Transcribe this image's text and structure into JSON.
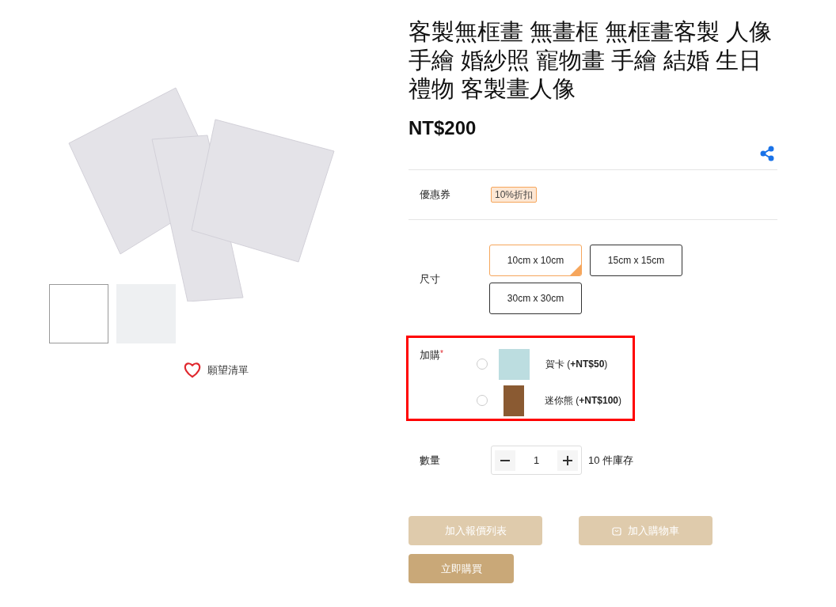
{
  "gallery": {
    "thumbnails": [
      {
        "selected": true
      },
      {
        "selected": false
      }
    ],
    "wishlist": {
      "label": "願望清單"
    }
  },
  "product": {
    "title": "客製無框畫 無畫框 無框畫客製 人像手繪 婚紗照 寵物畫 手繪 結婚 生日禮物 客製畫人像",
    "price": "NT$200"
  },
  "coupon": {
    "label": "優惠券",
    "tag": "10%折扣"
  },
  "size": {
    "label": "尺寸",
    "options": [
      {
        "label": "10cm x 10cm",
        "selected": true
      },
      {
        "label": "15cm x 15cm",
        "selected": false
      },
      {
        "label": "30cm x 30cm",
        "selected": false
      }
    ]
  },
  "addons": {
    "label": "加購",
    "required_mark": "*",
    "highlighted": true,
    "options": [
      {
        "label": "賀卡 (**+NT$50**)",
        "selected": false
      },
      {
        "label": "迷你熊 (**+NT$100**)",
        "selected": false
      }
    ]
  },
  "quantity": {
    "label": "數量",
    "value": "1",
    "stock": "10 件庫存"
  },
  "buttons": [
    {
      "label": "加入報價列表",
      "kind": "quote",
      "disabled": true
    },
    {
      "label": "加入購物車",
      "kind": "cart",
      "disabled": true
    },
    {
      "label": "立即購買",
      "kind": "buy",
      "disabled": false
    }
  ]
}
